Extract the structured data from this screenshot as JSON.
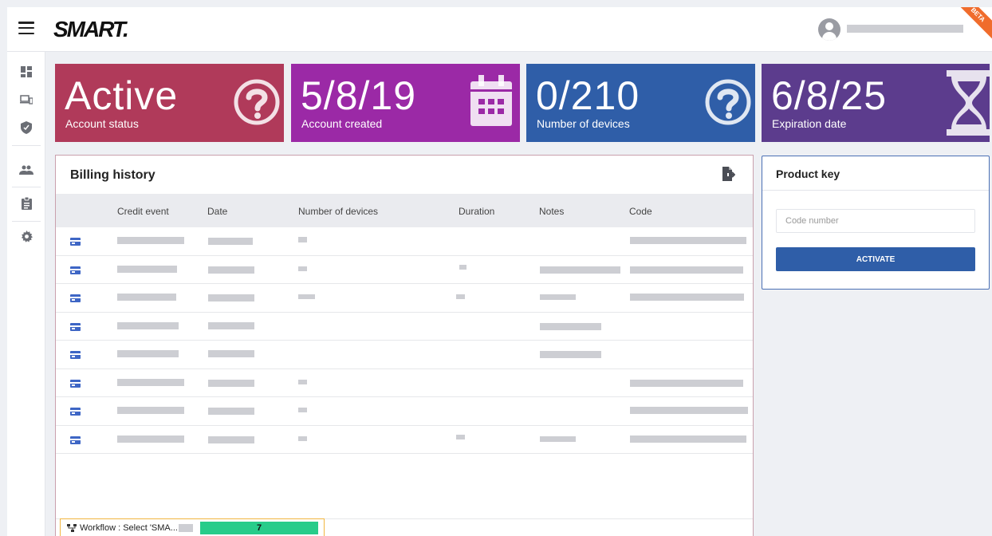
{
  "app": {
    "logo_text": "SMART.",
    "beta_label": "BETA"
  },
  "sidebar": {
    "items": [
      {
        "name": "sidebar-item-dashboard",
        "icon": "dashboard-icon"
      },
      {
        "name": "sidebar-item-devices",
        "icon": "devices-icon"
      },
      {
        "name": "sidebar-item-security",
        "icon": "shield-icon"
      },
      {
        "name": "sidebar-item-users",
        "icon": "people-icon"
      },
      {
        "name": "sidebar-item-reports",
        "icon": "clipboard-icon"
      },
      {
        "name": "sidebar-item-settings",
        "icon": "gear-icon"
      }
    ]
  },
  "stats": [
    {
      "value": "Active",
      "label": "Account status",
      "color": "#b03a5a",
      "icon": "question-icon"
    },
    {
      "value": "5/8/19",
      "label": "Account created",
      "color": "#9b29a6",
      "icon": "calendar-icon"
    },
    {
      "value": "0/210",
      "label": "Number of devices",
      "color": "#2f5ea8",
      "icon": "question-icon"
    },
    {
      "value": "6/8/25",
      "label": "Expiration date",
      "color": "#5c3c8d",
      "icon": "hourglass-icon"
    }
  ],
  "billing": {
    "title": "Billing history",
    "columns": [
      "Credit event",
      "Date",
      "Number of devices",
      "Duration",
      "Notes",
      "Code"
    ]
  },
  "workflow": {
    "label": "Workflow : Select 'SMA...",
    "count": "7"
  },
  "product_key": {
    "title": "Product key",
    "placeholder": "Code number",
    "button_label": "ACTIVATE"
  },
  "colors": {
    "accent": "#2f5ea8",
    "card_icon": "#3e66c5",
    "workflow_green": "#27cc8a"
  }
}
